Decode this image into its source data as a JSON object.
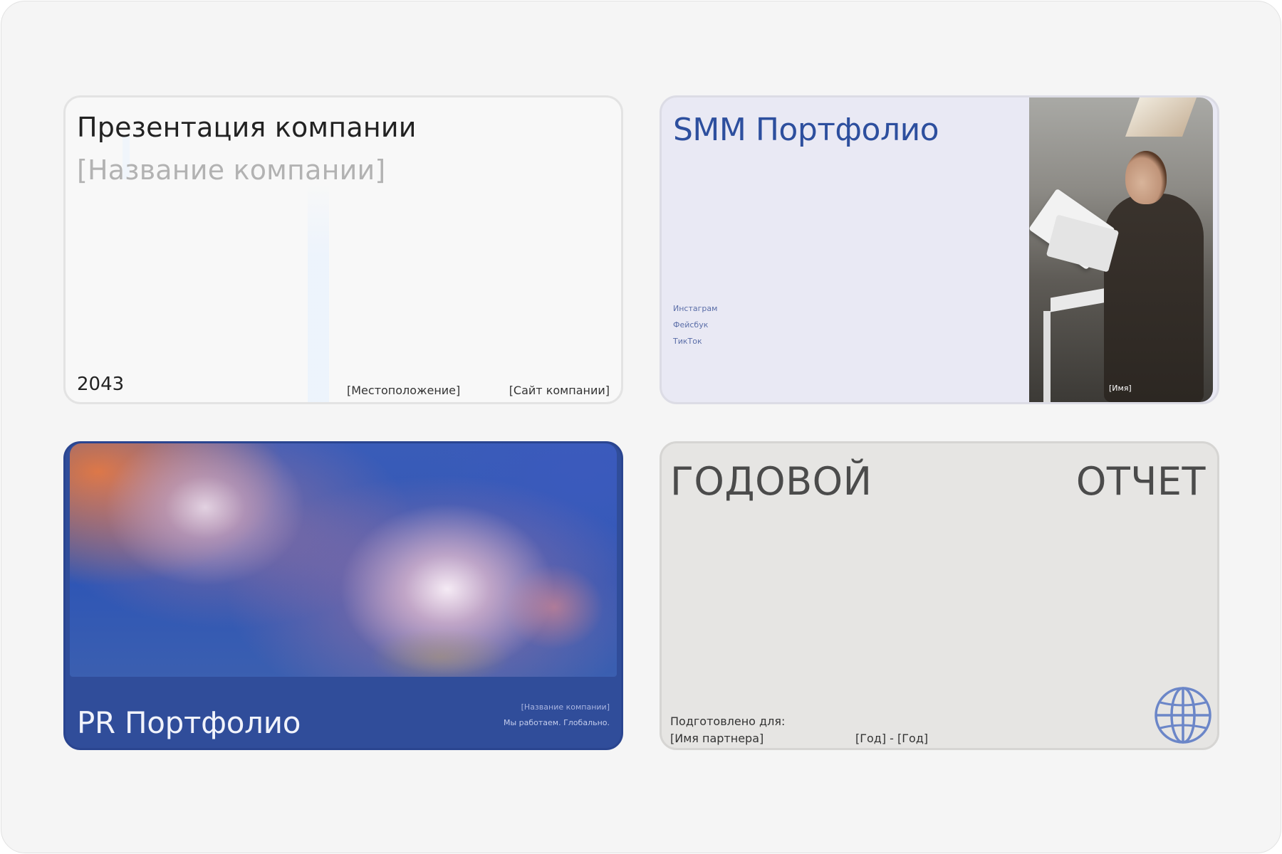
{
  "templates": {
    "company": {
      "title": "Презентация компании",
      "subtitle": "[Название компании]",
      "year": "2043",
      "location": "[Местоположение]",
      "website": "[Сайт компании]"
    },
    "smm": {
      "title": "SMM Портфолио",
      "social": [
        "Инстаграм",
        "Фейсбук",
        "ТикТок"
      ],
      "photo_caption": "[Имя]"
    },
    "pr": {
      "title": "PR Портфолио",
      "company": "[Название компании]",
      "slogan": "Мы работаем. Глобально."
    },
    "annual": {
      "title_left": "ГОДОВОЙ",
      "title_right": "ОТЧЕТ",
      "prepared_for": "Подготовлено для:",
      "partner": "[Имя партнера]",
      "years": "[Год] - [Год]",
      "icon": "globe-icon",
      "icon_color": "#6b86c8"
    }
  },
  "colors": {
    "background": "#f5f5f5",
    "smm_accent": "#2d4f9e",
    "pr_background": "#304d9a",
    "annual_background": "#e6e5e3"
  }
}
